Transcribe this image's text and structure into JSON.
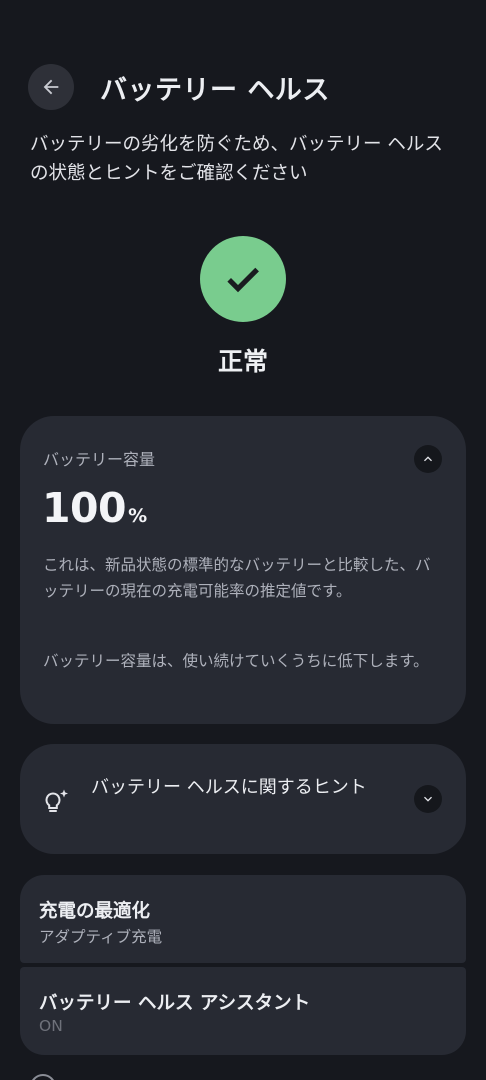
{
  "header": {
    "title": "バッテリー ヘルス"
  },
  "description": "バッテリーの劣化を防ぐため、バッテリー ヘルスの状態とヒントをご確認ください",
  "status": {
    "label": "正常",
    "color": "#79cc8e",
    "icon": "checkmark-icon"
  },
  "capacity_card": {
    "label": "バッテリー容量",
    "value": "100",
    "unit": "%",
    "expanded": true,
    "paragraph1": "これは、新品状態の標準的なバッテリーと比較した、バッテリーの現在の充電可能率の推定値です。",
    "paragraph2": "バッテリー容量は、使い続けていくうちに低下します。"
  },
  "tips_card": {
    "label": "バッテリー ヘルスに関するヒント",
    "icon": "lightbulb-sparkle-icon",
    "expanded": false
  },
  "settings": [
    {
      "title": "充電の最適化",
      "subtitle": "アダプティブ充電"
    },
    {
      "title": "バッテリー ヘルス アシスタント",
      "subtitle": "ON"
    }
  ]
}
